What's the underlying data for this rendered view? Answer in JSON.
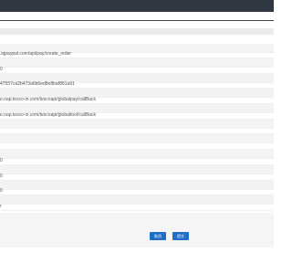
{
  "form": {
    "rows": [
      {
        "value": ""
      },
      {
        "value": ""
      },
      {
        "value": ".iqpaypal.com/api/pay/create_order"
      },
      {
        "value": ""
      },
      {
        "value": "0"
      },
      {
        "value": ""
      },
      {
        "value": "47557ca2b473a6b6ed8e8baf861a91"
      },
      {
        "value": ""
      },
      {
        "value": "e.nap.tesco-in.com/tescoapi/globalpay/callBack"
      },
      {
        "value": ""
      },
      {
        "value": "e.nap.tesco-in.com/tescoapi/globaltool/callBack"
      },
      {
        "value": ""
      },
      {
        "value": ""
      },
      {
        "value": ""
      },
      {
        "value": ""
      },
      {
        "value": ""
      },
      {
        "value": "0"
      },
      {
        "value": ""
      },
      {
        "value": "0"
      },
      {
        "value": ""
      },
      {
        "value": "0"
      },
      {
        "value": ""
      },
      {
        "value": "r"
      }
    ]
  },
  "actions": {
    "confirm_label": "提交",
    "cancel_label": "取消"
  },
  "colors": {
    "topbar": "#2f3742",
    "button": "#1f6fc9"
  }
}
